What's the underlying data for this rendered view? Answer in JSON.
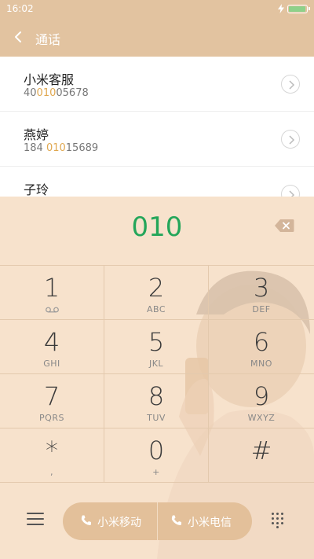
{
  "status_bar": {
    "time": "16:02"
  },
  "app_bar": {
    "title": "通话"
  },
  "contacts": [
    {
      "name": "小米客服",
      "number_pre": "40",
      "number_hl": "010",
      "number_post": "05678"
    },
    {
      "name": "燕婷",
      "number_pre": "184 ",
      "number_hl": "010",
      "number_post": "15689"
    },
    {
      "name": "子玲",
      "number_pre": "",
      "number_hl": "",
      "number_post": ""
    }
  ],
  "dialer": {
    "display": "010",
    "keys": [
      {
        "digit": "1",
        "letters": ""
      },
      {
        "digit": "2",
        "letters": "ABC"
      },
      {
        "digit": "3",
        "letters": "DEF"
      },
      {
        "digit": "4",
        "letters": "GHI"
      },
      {
        "digit": "5",
        "letters": "JKL"
      },
      {
        "digit": "6",
        "letters": "MNO"
      },
      {
        "digit": "7",
        "letters": "PQRS"
      },
      {
        "digit": "8",
        "letters": "TUV"
      },
      {
        "digit": "9",
        "letters": "WXYZ"
      },
      {
        "digit": "*",
        "letters": ","
      },
      {
        "digit": "0",
        "letters": "+"
      },
      {
        "digit": "#",
        "letters": ""
      }
    ]
  },
  "call_buttons": [
    {
      "label": "小米移动"
    },
    {
      "label": "小米电信"
    }
  ],
  "colors": {
    "accent": "#e2c3a0",
    "digits": "#24a65a",
    "highlight": "#e0a850"
  },
  "icons": {
    "back": "chevron-left-icon",
    "delete": "backspace-icon",
    "voicemail": "voicemail-icon",
    "menu": "menu-icon",
    "phone": "phone-icon",
    "keypad": "keypad-icon"
  }
}
